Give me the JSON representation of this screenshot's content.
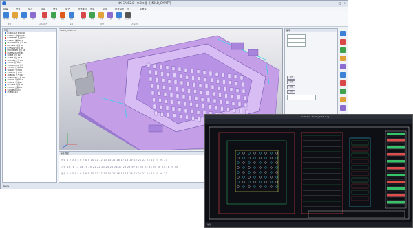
{
  "cam": {
    "title": "NX CAM 2.0 - 프로그램 - [MOLD_CAVITY]",
    "menu": [
      "파일",
      "편집",
      "보기",
      "삽입",
      "형식",
      "도구",
      "어셈블리",
      "정보",
      "분석",
      "환경설정",
      "창",
      "도움말"
    ],
    "ribbon_groups": [
      "파일",
      "시뮬레이션",
      "공정",
      "작업",
      "가공정보"
    ],
    "ribbon_buttons": [
      {
        "label": "새 파일",
        "icon": "new-file-icon",
        "color": "#3b82d6"
      },
      {
        "label": "열기",
        "icon": "open-icon",
        "color": "#e2a23a"
      },
      {
        "label": "저장",
        "icon": "save-icon",
        "color": "#3b82d6"
      },
      {
        "label": "설정",
        "icon": "settings-icon",
        "color": "#8c6bd0"
      },
      {
        "label": "공구",
        "icon": "tool-icon",
        "color": "#d94848"
      },
      {
        "label": "시뮬",
        "icon": "simulate-icon",
        "color": "#3fa34d"
      },
      {
        "label": "검증",
        "icon": "verify-icon",
        "color": "#e05a1a"
      },
      {
        "label": "정보",
        "icon": "info-icon",
        "color": "#3b82d6"
      },
      {
        "label": "황삭",
        "icon": "rough-icon",
        "color": "#d94848"
      },
      {
        "label": "정삭",
        "icon": "finish-icon",
        "color": "#3fa34d"
      },
      {
        "label": "윤곽",
        "icon": "contour-icon",
        "color": "#e2a23a"
      },
      {
        "label": "드릴",
        "icon": "drill-icon",
        "color": "#8c6bd0"
      },
      {
        "label": "측정",
        "icon": "measure-icon",
        "color": "#3b82d6"
      },
      {
        "label": "보고서",
        "icon": "report-icon",
        "color": "#555555"
      }
    ],
    "tree_header": "작업",
    "tree_items": [
      "01 ROUGH 황삭 D16",
      "02 REST 잔삭 D10R1",
      "03 ZLEVEL 등고선 D8",
      "04 FLAT 평면 D12",
      "05 CONTOUR 윤곽 D6",
      "06 FINISH 정삭 B8",
      "07 FINISH 정삭 B6",
      "08 CORNER 코너 B4",
      "09 PENCIL 펜슬 B3",
      "10 RIB 리브 D2",
      "11 RIB 리브 D1.5",
      "12 DRILL 드릴 D8",
      "13 TAP 탭 M10",
      "14 CHAMFER 면취",
      "15 FACE 면삭 D50",
      "16 SLOT 슬롯 D6",
      "17 HOLE 홀 D20",
      "18 BOSS 보스 D10",
      "19 POCKET 포켓 D8",
      "20 SIDE 측면 D12",
      "21 REST 잔삭 B2",
      "22 FINISH 정삭 B2",
      "23 TRIM 트림 D4",
      "24 CHECK 검사",
      "25 END 종료"
    ],
    "viewport_title": "MOLD_CORE.prt",
    "right_panel": {
      "title": "공구",
      "buttons": [
        "확인",
        "취소",
        "적용",
        "닫기"
      ]
    },
    "bottom": {
      "header": "공정 정보",
      "row1": "작업  1  2  3  4  5  6  7  8  9  10  11  12  13  14  15  16  17  18  19  20  21  22  23  24  25  26  27",
      "row2": "가공  15  16  17  18  19  20  21  22  23  24  25  26  27  28  29  30  31  32  33  34  35  36  37  38  39  40",
      "row3": "공구  1  2  3  4  5  6  7  8  9  10  11  12  13  14  15  16  17  18  19  20  21  22  23  24  25  26  27"
    },
    "status": "Ready"
  },
  "cad": {
    "title": "CAD 2D - MOLD_BASE.dwg",
    "command": "명령:"
  },
  "colors": {
    "mold_body": "#c9a6ee",
    "mold_shadow": "#9a7ad0",
    "cad_line": "#e24a4a",
    "cad_green": "#36c46a",
    "cad_cyan": "#3ad0e8"
  }
}
